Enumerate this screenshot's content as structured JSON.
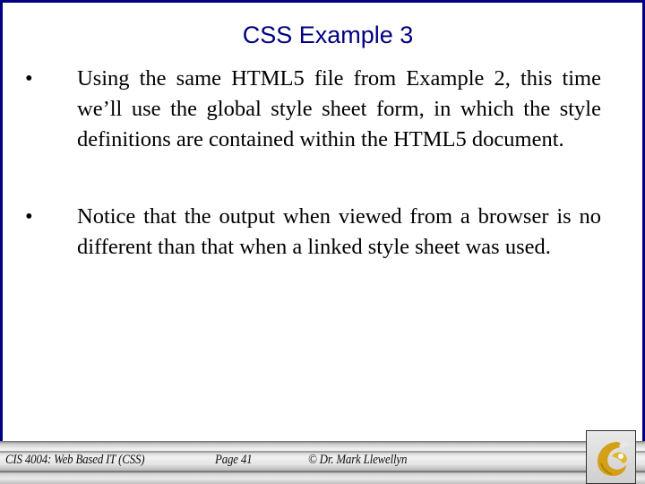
{
  "slide": {
    "title": "CSS Example 3",
    "bullets": [
      {
        "marker": "•",
        "text": "Using the same HTML5 file from Example 2, this time we’ll use the global style sheet form, in which the style definitions are contained within the HTML5 document."
      },
      {
        "marker": "•",
        "text": "Notice that the output when viewed from a browser is no different than that when a linked style sheet was used."
      }
    ]
  },
  "footer": {
    "course": "CIS 4004: Web Based IT (CSS)",
    "page": "Page 41",
    "author": "© Dr. Mark Llewellyn",
    "logo_icon": "pegasus-logo-icon"
  },
  "colors": {
    "frame": "#000080",
    "title": "#000080",
    "logo": "#d4a017"
  }
}
